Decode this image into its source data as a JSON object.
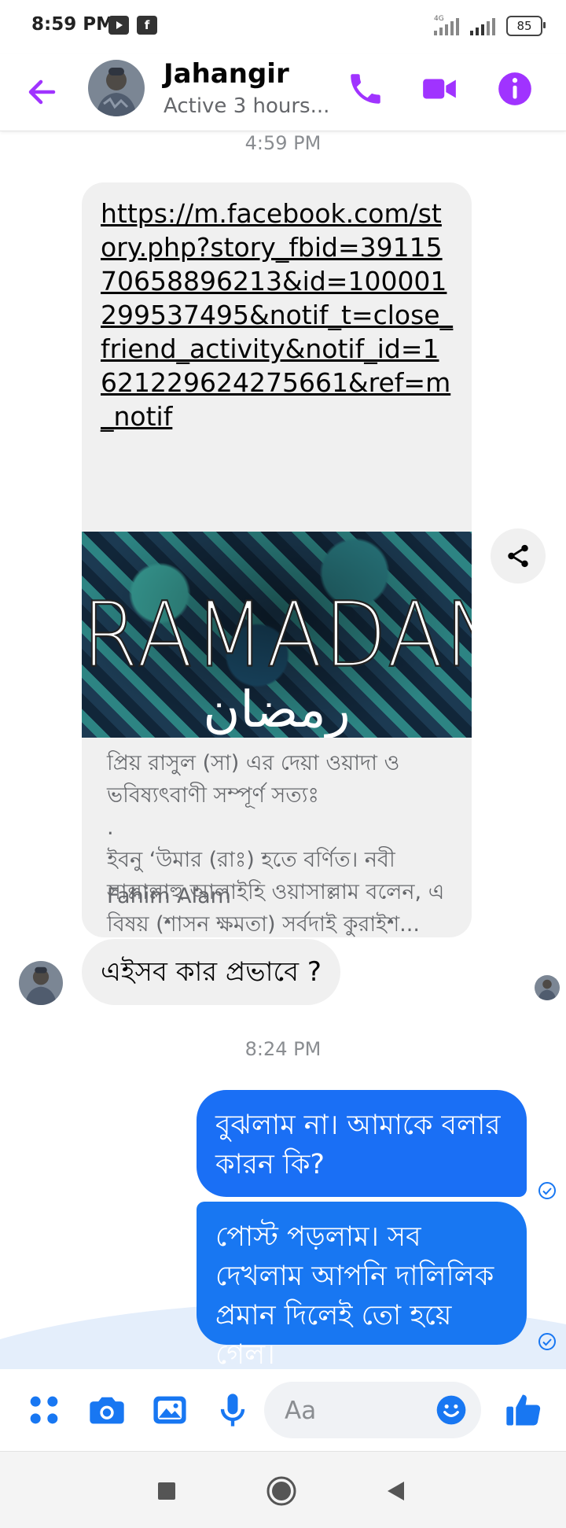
{
  "status_bar": {
    "time": "8:59 PM",
    "youtube_icon": "youtube-icon",
    "facebook_icon": "f",
    "network": "4G",
    "battery": "85"
  },
  "header": {
    "contact_name": "Jahangir",
    "contact_status": "Active 3 hours...",
    "icons": [
      "back-arrow-icon",
      "phone-icon",
      "video-camera-icon",
      "info-icon"
    ],
    "accent_color": "#a033ff"
  },
  "chat": {
    "timestamp_1": "4:59 PM",
    "link_card": {
      "url": "https://m.facebook.com/story.php?story_fbid=3911570658896213&id=100001299537495&notif_t=close_friend_activity&notif_id=1621229624275661&ref=m_notif",
      "image_title": "RAMADAN",
      "image_subtitle": "رمضان",
      "description_lines": [
        "প্রিয় রাসুল (সা) এর দেয়া ওয়াদা ও",
        "ভবিষ্যৎবাণী সম্পূর্ণ সত্যঃ",
        ".",
        "ইবনু ‘উমার (রাঃ) হতে বর্ণিত। নবী",
        "সাল্লাল্লাহু আলাইহি ওয়াসাল্লাম বলেন, এ",
        "বিষয় (শাসন ক্ষমতা) সর্বদাই কুরাইশ..."
      ],
      "author": "Fahim Alam"
    },
    "incoming_message": "এইসব কার  প্রভাবে ?",
    "timestamp_2": "8:24 PM",
    "outgoing_messages": [
      "বুঝলাম না। আমাকে বলার কারন কি?",
      "পোস্ট পড়লাম। সব দেখলাম আপনি দালিলিক প্রমান দিলেই তো হয়ে গেল।"
    ],
    "outgoing_color": "#1877f2"
  },
  "composer": {
    "placeholder": "Aa",
    "icons": [
      "menu-dots-icon",
      "camera-icon",
      "gallery-icon",
      "microphone-icon",
      "emoji-icon",
      "thumbs-up-icon"
    ],
    "accent_color": "#1877f2"
  },
  "navbar": {
    "icons": [
      "recent-apps-icon",
      "home-icon",
      "back-icon"
    ]
  }
}
